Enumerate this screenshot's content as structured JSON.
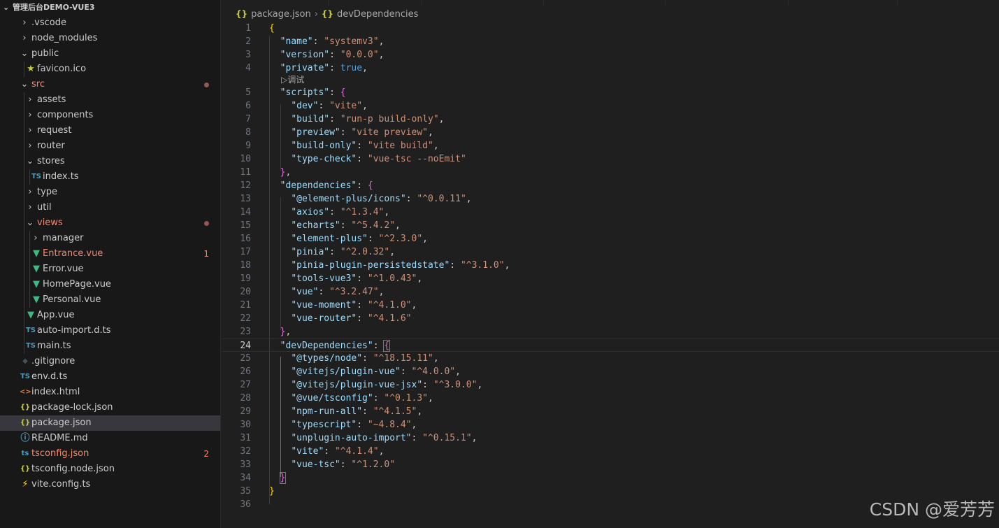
{
  "explorer": {
    "project_title": "管理后台DEMO-VUE3",
    "items": [
      {
        "label": ".vscode",
        "depth": 0,
        "kind": "folder",
        "open": false
      },
      {
        "label": "node_modules",
        "depth": 0,
        "kind": "folder",
        "open": false
      },
      {
        "label": "public",
        "depth": 0,
        "kind": "folder",
        "open": true
      },
      {
        "label": "favicon.ico",
        "depth": 1,
        "kind": "file",
        "icon": "star-icon",
        "glyph": "★",
        "color": "#cbcb41"
      },
      {
        "label": "src",
        "depth": 0,
        "kind": "folder",
        "open": true,
        "error": true,
        "dot": true
      },
      {
        "label": "assets",
        "depth": 1,
        "kind": "folder",
        "open": false
      },
      {
        "label": "components",
        "depth": 1,
        "kind": "folder",
        "open": false
      },
      {
        "label": "request",
        "depth": 1,
        "kind": "folder",
        "open": false
      },
      {
        "label": "router",
        "depth": 1,
        "kind": "folder",
        "open": false
      },
      {
        "label": "stores",
        "depth": 1,
        "kind": "folder",
        "open": true
      },
      {
        "label": "index.ts",
        "depth": 2,
        "kind": "file",
        "icon": "typescript-icon",
        "glyph": "TS",
        "color": "#519aba"
      },
      {
        "label": "type",
        "depth": 1,
        "kind": "folder",
        "open": false
      },
      {
        "label": "util",
        "depth": 1,
        "kind": "folder",
        "open": false
      },
      {
        "label": "views",
        "depth": 1,
        "kind": "folder",
        "open": true,
        "error": true,
        "dot": true
      },
      {
        "label": "manager",
        "depth": 2,
        "kind": "folder",
        "open": false
      },
      {
        "label": "Entrance.vue",
        "depth": 2,
        "kind": "file",
        "icon": "vue-icon",
        "glyph": "▼",
        "color": "#41b883",
        "error": true,
        "badge": "1"
      },
      {
        "label": "Error.vue",
        "depth": 2,
        "kind": "file",
        "icon": "vue-icon",
        "glyph": "▼",
        "color": "#41b883"
      },
      {
        "label": "HomePage.vue",
        "depth": 2,
        "kind": "file",
        "icon": "vue-icon",
        "glyph": "▼",
        "color": "#41b883"
      },
      {
        "label": "Personal.vue",
        "depth": 2,
        "kind": "file",
        "icon": "vue-icon",
        "glyph": "▼",
        "color": "#41b883"
      },
      {
        "label": "App.vue",
        "depth": 1,
        "kind": "file",
        "icon": "vue-icon",
        "glyph": "▼",
        "color": "#41b883"
      },
      {
        "label": "auto-import.d.ts",
        "depth": 1,
        "kind": "file",
        "icon": "typescript-icon",
        "glyph": "TS",
        "color": "#519aba"
      },
      {
        "label": "main.ts",
        "depth": 1,
        "kind": "file",
        "icon": "typescript-icon",
        "glyph": "TS",
        "color": "#519aba"
      },
      {
        "label": ".gitignore",
        "depth": 0,
        "kind": "file",
        "icon": "git-icon",
        "glyph": "◆",
        "color": "#41535b"
      },
      {
        "label": "env.d.ts",
        "depth": 0,
        "kind": "file",
        "icon": "typescript-icon",
        "glyph": "TS",
        "color": "#519aba"
      },
      {
        "label": "index.html",
        "depth": 0,
        "kind": "file",
        "icon": "html-icon",
        "glyph": "<>",
        "color": "#e37933"
      },
      {
        "label": "package-lock.json",
        "depth": 0,
        "kind": "file",
        "icon": "json-icon",
        "glyph": "{}",
        "color": "#cbcb41"
      },
      {
        "label": "package.json",
        "depth": 0,
        "kind": "file",
        "icon": "json-icon",
        "glyph": "{}",
        "color": "#cbcb41",
        "selected": true
      },
      {
        "label": "README.md",
        "depth": 0,
        "kind": "file",
        "icon": "info-icon",
        "glyph": "ⓘ",
        "color": "#519aba"
      },
      {
        "label": "tsconfig.json",
        "depth": 0,
        "kind": "file",
        "icon": "tsconfig-icon",
        "glyph": "ts",
        "color": "#519aba",
        "error": true,
        "badge": "2"
      },
      {
        "label": "tsconfig.node.json",
        "depth": 0,
        "kind": "file",
        "icon": "json-icon",
        "glyph": "{}",
        "color": "#cbcb41"
      },
      {
        "label": "vite.config.ts",
        "depth": 0,
        "kind": "file",
        "icon": "vite-icon",
        "glyph": "⚡",
        "color": "#ffd62e"
      }
    ]
  },
  "breadcrumb": {
    "file": "package.json",
    "symbol": "devDependencies",
    "file_icon": "{}",
    "symbol_icon": "{}"
  },
  "editor": {
    "active_line": 24,
    "codelens": "▷调试",
    "lines": [
      [
        [
          "b1",
          "{"
        ]
      ],
      [
        [
          "p",
          "  "
        ],
        [
          "k",
          "\"name\""
        ],
        [
          "p",
          ": "
        ],
        [
          "s",
          "\"systemv3\""
        ],
        [
          "p",
          ","
        ]
      ],
      [
        [
          "p",
          "  "
        ],
        [
          "k",
          "\"version\""
        ],
        [
          "p",
          ": "
        ],
        [
          "s",
          "\"0.0.0\""
        ],
        [
          "p",
          ","
        ]
      ],
      [
        [
          "p",
          "  "
        ],
        [
          "k",
          "\"private\""
        ],
        [
          "p",
          ": "
        ],
        [
          "b",
          "true"
        ],
        [
          "p",
          ","
        ]
      ],
      [
        [
          "p",
          "  "
        ],
        [
          "k",
          "\"scripts\""
        ],
        [
          "p",
          ": "
        ],
        [
          "b2",
          "{"
        ]
      ],
      [
        [
          "p",
          "    "
        ],
        [
          "k",
          "\"dev\""
        ],
        [
          "p",
          ": "
        ],
        [
          "s",
          "\"vite\""
        ],
        [
          "p",
          ","
        ]
      ],
      [
        [
          "p",
          "    "
        ],
        [
          "k",
          "\"build\""
        ],
        [
          "p",
          ": "
        ],
        [
          "s",
          "\"run-p build-only\""
        ],
        [
          "p",
          ","
        ]
      ],
      [
        [
          "p",
          "    "
        ],
        [
          "k",
          "\"preview\""
        ],
        [
          "p",
          ": "
        ],
        [
          "s",
          "\"vite preview\""
        ],
        [
          "p",
          ","
        ]
      ],
      [
        [
          "p",
          "    "
        ],
        [
          "k",
          "\"build-only\""
        ],
        [
          "p",
          ": "
        ],
        [
          "s",
          "\"vite build\""
        ],
        [
          "p",
          ","
        ]
      ],
      [
        [
          "p",
          "    "
        ],
        [
          "k",
          "\"type-check\""
        ],
        [
          "p",
          ": "
        ],
        [
          "s",
          "\"vue-tsc --noEmit\""
        ]
      ],
      [
        [
          "p",
          "  "
        ],
        [
          "b2",
          "}"
        ],
        [
          "p",
          ","
        ]
      ],
      [
        [
          "p",
          "  "
        ],
        [
          "k",
          "\"dependencies\""
        ],
        [
          "p",
          ": "
        ],
        [
          "b2",
          "{"
        ]
      ],
      [
        [
          "p",
          "    "
        ],
        [
          "k",
          "\"@element-plus/icons\""
        ],
        [
          "p",
          ": "
        ],
        [
          "s",
          "\"^0.0.11\""
        ],
        [
          "p",
          ","
        ]
      ],
      [
        [
          "p",
          "    "
        ],
        [
          "k",
          "\"axios\""
        ],
        [
          "p",
          ": "
        ],
        [
          "s",
          "\"^1.3.4\""
        ],
        [
          "p",
          ","
        ]
      ],
      [
        [
          "p",
          "    "
        ],
        [
          "k",
          "\"echarts\""
        ],
        [
          "p",
          ": "
        ],
        [
          "s",
          "\"^5.4.2\""
        ],
        [
          "p",
          ","
        ]
      ],
      [
        [
          "p",
          "    "
        ],
        [
          "k",
          "\"element-plus\""
        ],
        [
          "p",
          ": "
        ],
        [
          "s",
          "\"^2.3.0\""
        ],
        [
          "p",
          ","
        ]
      ],
      [
        [
          "p",
          "    "
        ],
        [
          "k",
          "\"pinia\""
        ],
        [
          "p",
          ": "
        ],
        [
          "s",
          "\"^2.0.32\""
        ],
        [
          "p",
          ","
        ]
      ],
      [
        [
          "p",
          "    "
        ],
        [
          "k",
          "\"pinia-plugin-persistedstate\""
        ],
        [
          "p",
          ": "
        ],
        [
          "s",
          "\"^3.1.0\""
        ],
        [
          "p",
          ","
        ]
      ],
      [
        [
          "p",
          "    "
        ],
        [
          "k",
          "\"tools-vue3\""
        ],
        [
          "p",
          ": "
        ],
        [
          "s",
          "\"^1.0.43\""
        ],
        [
          "p",
          ","
        ]
      ],
      [
        [
          "p",
          "    "
        ],
        [
          "k",
          "\"vue\""
        ],
        [
          "p",
          ": "
        ],
        [
          "s",
          "\"^3.2.47\""
        ],
        [
          "p",
          ","
        ]
      ],
      [
        [
          "p",
          "    "
        ],
        [
          "k",
          "\"vue-moment\""
        ],
        [
          "p",
          ": "
        ],
        [
          "s",
          "\"^4.1.0\""
        ],
        [
          "p",
          ","
        ]
      ],
      [
        [
          "p",
          "    "
        ],
        [
          "k",
          "\"vue-router\""
        ],
        [
          "p",
          ": "
        ],
        [
          "s",
          "\"^4.1.6\""
        ]
      ],
      [
        [
          "p",
          "  "
        ],
        [
          "b2",
          "}"
        ],
        [
          "p",
          ","
        ]
      ],
      [
        [
          "p",
          "  "
        ],
        [
          "k",
          "\"devDependencies\""
        ],
        [
          "p",
          ": "
        ],
        [
          "b2x",
          "{"
        ]
      ],
      [
        [
          "p",
          "    "
        ],
        [
          "k",
          "\"@types/node\""
        ],
        [
          "p",
          ": "
        ],
        [
          "s",
          "\"^18.15.11\""
        ],
        [
          "p",
          ","
        ]
      ],
      [
        [
          "p",
          "    "
        ],
        [
          "k",
          "\"@vitejs/plugin-vue\""
        ],
        [
          "p",
          ": "
        ],
        [
          "s",
          "\"^4.0.0\""
        ],
        [
          "p",
          ","
        ]
      ],
      [
        [
          "p",
          "    "
        ],
        [
          "k",
          "\"@vitejs/plugin-vue-jsx\""
        ],
        [
          "p",
          ": "
        ],
        [
          "s",
          "\"^3.0.0\""
        ],
        [
          "p",
          ","
        ]
      ],
      [
        [
          "p",
          "    "
        ],
        [
          "k",
          "\"@vue/tsconfig\""
        ],
        [
          "p",
          ": "
        ],
        [
          "s",
          "\"^0.1.3\""
        ],
        [
          "p",
          ","
        ]
      ],
      [
        [
          "p",
          "    "
        ],
        [
          "k",
          "\"npm-run-all\""
        ],
        [
          "p",
          ": "
        ],
        [
          "s",
          "\"^4.1.5\""
        ],
        [
          "p",
          ","
        ]
      ],
      [
        [
          "p",
          "    "
        ],
        [
          "k",
          "\"typescript\""
        ],
        [
          "p",
          ": "
        ],
        [
          "s",
          "\"~4.8.4\""
        ],
        [
          "p",
          ","
        ]
      ],
      [
        [
          "p",
          "    "
        ],
        [
          "k",
          "\"unplugin-auto-import\""
        ],
        [
          "p",
          ": "
        ],
        [
          "s",
          "\"^0.15.1\""
        ],
        [
          "p",
          ","
        ]
      ],
      [
        [
          "p",
          "    "
        ],
        [
          "k",
          "\"vite\""
        ],
        [
          "p",
          ": "
        ],
        [
          "s",
          "\"^4.1.4\""
        ],
        [
          "p",
          ","
        ]
      ],
      [
        [
          "p",
          "    "
        ],
        [
          "k",
          "\"vue-tsc\""
        ],
        [
          "p",
          ": "
        ],
        [
          "s",
          "\"^1.2.0\""
        ]
      ],
      [
        [
          "p",
          "  "
        ],
        [
          "b2x",
          "}"
        ]
      ],
      [
        [
          "b1",
          "}"
        ]
      ],
      []
    ]
  },
  "watermark": "CSDN @爱芳芳",
  "colors": {
    "key": "#9cdcfe",
    "string": "#ce9178",
    "keyword": "#569cd6",
    "bracket_level1": "#ffd700",
    "bracket_level2": "#da70d6",
    "error": "#f48771"
  }
}
